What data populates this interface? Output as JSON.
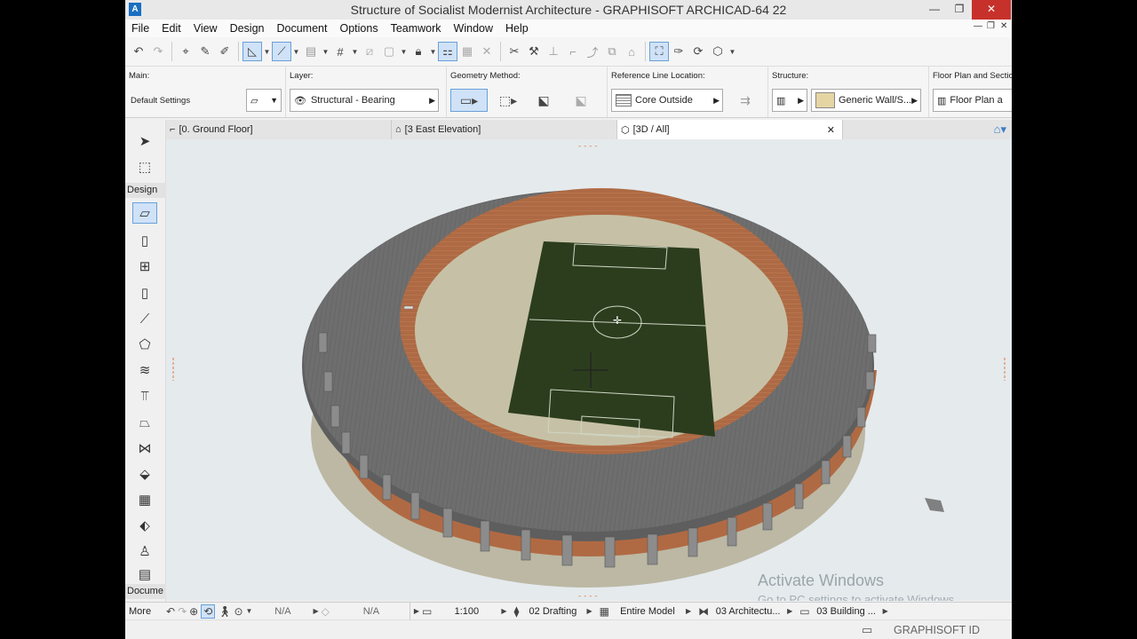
{
  "window": {
    "title": "Structure of Socialist Modernist Architecture - GRAPHISOFT ARCHICAD-64 22",
    "minimize": "—",
    "restore": "❐",
    "close": "✕"
  },
  "menu": [
    "File",
    "Edit",
    "View",
    "Design",
    "Document",
    "Options",
    "Teamwork",
    "Window",
    "Help"
  ],
  "infobox": {
    "main_label": "Main:",
    "main_value": "Default Settings",
    "layer_label": "Layer:",
    "layer_value": "Structural - Bearing",
    "geometry_label": "Geometry Method:",
    "refline_label": "Reference Line Location:",
    "refline_value": "Core Outside",
    "structure_label": "Structure:",
    "structure_value": "Generic Wall/S...",
    "floorplan_label": "Floor Plan and Section:",
    "floorplan_value": "Floor Plan a"
  },
  "toolbox": {
    "design_label": "Design",
    "document_label": "Docume",
    "more_label": "More"
  },
  "tabs": [
    {
      "label": "[0. Ground Floor]",
      "icon": "floor-plan-icon"
    },
    {
      "label": "[3 East Elevation]",
      "icon": "elevation-icon"
    },
    {
      "label": "[3D / All]",
      "icon": "3d-icon",
      "close": "✕"
    }
  ],
  "status": {
    "nav1": "N/A",
    "nav2": "N/A",
    "scale": "1:100",
    "pen_set": "02 Drafting",
    "model_view": "Entire Model",
    "layer_combo": "03 Architectu...",
    "dimension": "03 Building ..."
  },
  "watermark": {
    "line1": "Activate Windows",
    "line2": "Go to PC settings to activate Windows."
  },
  "brand": "GRAPHISOFT ID",
  "colors": {
    "accent": "#cfe2f7",
    "roof": "#6d6d6d",
    "brick": "#b0683e",
    "pitch": "#2c3d1e",
    "ground": "#c6c1a6",
    "viewport_bg": "#e5eaed"
  }
}
